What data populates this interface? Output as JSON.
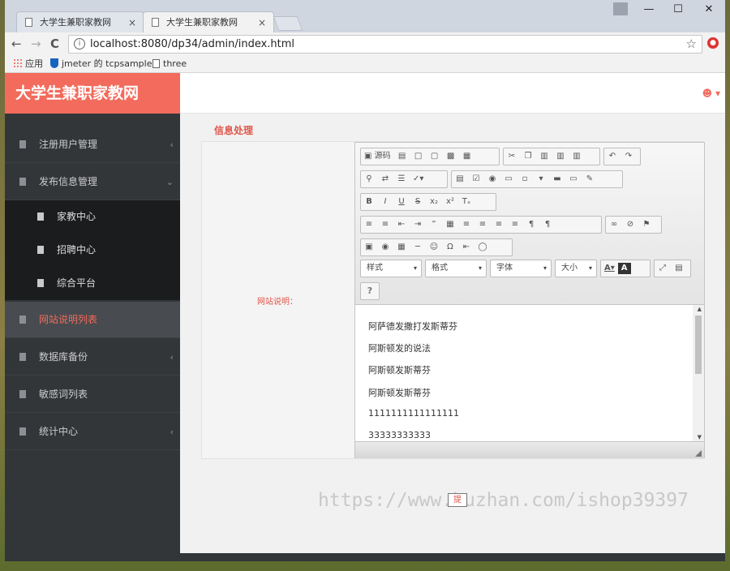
{
  "browser": {
    "tabs": [
      {
        "title": "大学生兼职家教网",
        "close": "×"
      },
      {
        "title": "大学生兼职家教网",
        "close": "×"
      }
    ],
    "url": "localhost:8080/dp34/admin/index.html",
    "nav": {
      "back": "←",
      "forward": "→",
      "reload": "C",
      "star": "☆",
      "minimize": "—",
      "maximize": "☐",
      "close": "✕"
    },
    "bookmarks": [
      "应用",
      "jmeter 的 tcpsample",
      "three"
    ]
  },
  "app": {
    "brand": "大学生兼职家教网",
    "user_icon": "user-icon",
    "sidebar": [
      {
        "label": "注册用户管理",
        "chev": "‹"
      },
      {
        "label": "发布信息管理",
        "chev": "⌄"
      },
      {
        "label": "网站说明列表",
        "chev": ""
      },
      {
        "label": "数据库备份",
        "chev": "‹"
      },
      {
        "label": "敏感词列表",
        "chev": ""
      },
      {
        "label": "统计中心",
        "chev": "‹"
      }
    ],
    "submenu": [
      "家教中心",
      "招聘中心",
      "综合平台"
    ],
    "page_title": "信息处理",
    "field_label": "网站说明：",
    "editor": {
      "source_label": "源码",
      "combos": [
        "样式",
        "格式",
        "字体",
        "大小"
      ],
      "help": "?",
      "paragraphs": [
        "阿萨德发撒打发斯蒂芬",
        "阿斯顿发的说法",
        "阿斯顿发斯蒂芬",
        "阿斯顿发斯蒂芬",
        "1111111111111111",
        "33333333333"
      ]
    },
    "watermark": "https://www.huzhan.com/ishop39397",
    "submit_label": "提"
  },
  "colors": {
    "accent": "#f26b5c",
    "sidebar": "#333639",
    "submenu": "#1b1c1e"
  }
}
